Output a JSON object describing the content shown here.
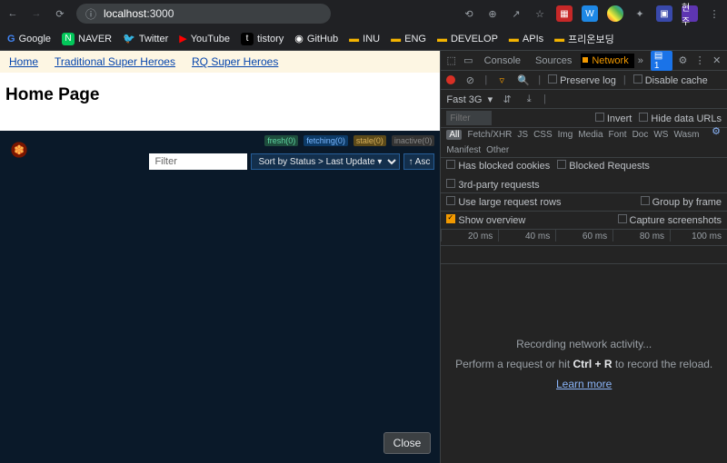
{
  "chrome": {
    "url_host": "localhost",
    "url_port": ":3000"
  },
  "bookmarks": [
    {
      "label": "Google",
      "kind": "g"
    },
    {
      "label": "NAVER",
      "kind": "n"
    },
    {
      "label": "Twitter",
      "kind": "tw"
    },
    {
      "label": "YouTube",
      "kind": "yt"
    },
    {
      "label": "tistory",
      "kind": "t"
    },
    {
      "label": "GitHub",
      "kind": "gh"
    },
    {
      "label": "INU",
      "kind": "folder"
    },
    {
      "label": "ENG",
      "kind": "folder"
    },
    {
      "label": "DEVELOP",
      "kind": "folder"
    },
    {
      "label": "APIs",
      "kind": "folder"
    },
    {
      "label": "프리온보딩",
      "kind": "folder"
    }
  ],
  "page": {
    "nav": [
      "Home",
      "Traditional Super Heroes",
      "RQ Super Heroes"
    ],
    "heading": "Home Page",
    "rq": {
      "chips": [
        {
          "text": "fresh(0)",
          "cls": "fresh"
        },
        {
          "text": "fetching(0)",
          "cls": "fetching"
        },
        {
          "text": "stale(0)",
          "cls": "stale"
        },
        {
          "text": "inactive(0)",
          "cls": "inactive"
        }
      ],
      "filter_placeholder": "Filter",
      "sort_label": "Sort by Status > Last Update ▾",
      "asc_label": "↑ Asc"
    },
    "close": "Close"
  },
  "devtools": {
    "tabs": {
      "console": "Console",
      "sources": "Sources",
      "network": "Network",
      "more": "»",
      "issues": "1"
    },
    "row1": {
      "preserve": "Preserve log",
      "disable": "Disable cache"
    },
    "throttle": "Fast 3G",
    "filter_placeholder": "Filter",
    "filter_opts": {
      "invert": "Invert",
      "hide": "Hide data URLs"
    },
    "types": [
      "All",
      "Fetch/XHR",
      "JS",
      "CSS",
      "Img",
      "Media",
      "Font",
      "Doc",
      "WS",
      "Wasm",
      "Manifest",
      "Other"
    ],
    "row_cookies": {
      "blocked": "Has blocked cookies",
      "breq": "Blocked Requests",
      "third": "3rd-party requests"
    },
    "row_large": {
      "large": "Use large request rows",
      "group": "Group by frame"
    },
    "row_overview": {
      "show": "Show overview",
      "capture": "Capture screenshots"
    },
    "ticks": [
      "20 ms",
      "40 ms",
      "60 ms",
      "80 ms",
      "100 ms"
    ],
    "msg": {
      "recording": "Recording network activity...",
      "hint_pre": "Perform a request or hit ",
      "hint_key": "Ctrl + R",
      "hint_post": " to record the reload.",
      "learn": "Learn more"
    }
  }
}
